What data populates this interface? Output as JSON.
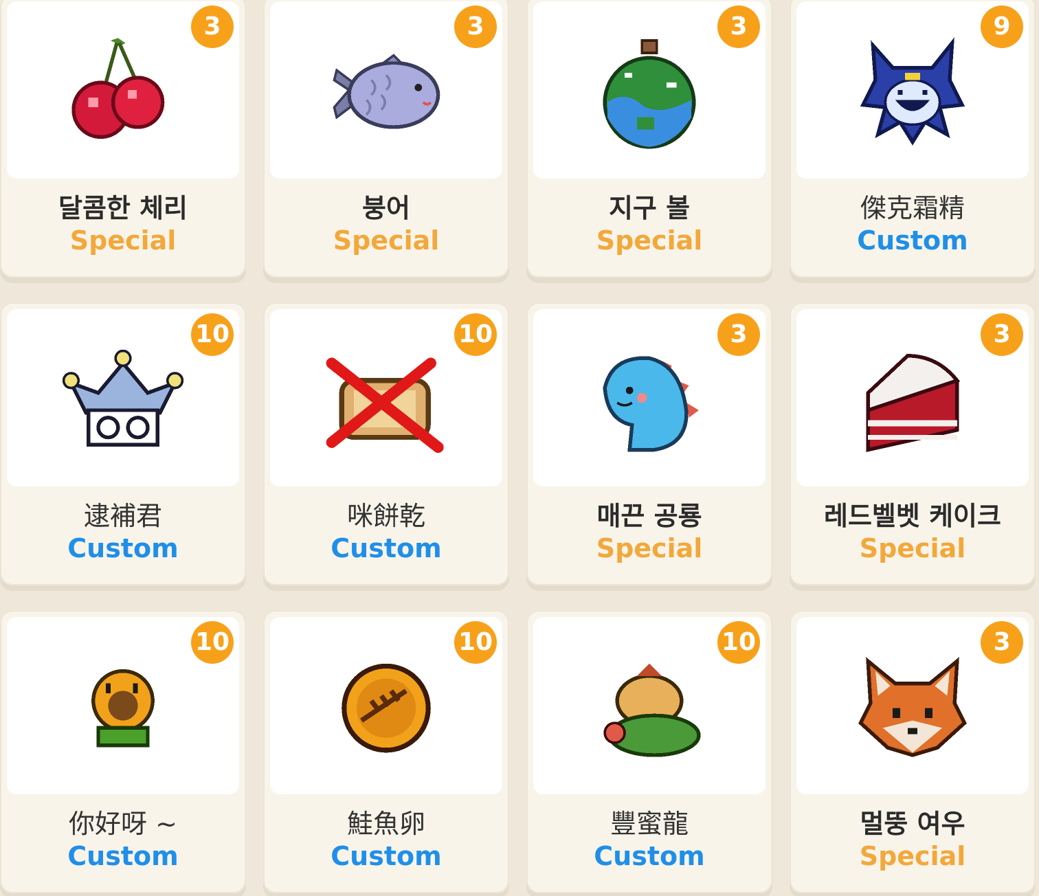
{
  "colors": {
    "special": "#f2a83a",
    "custom": "#1f8fe8",
    "badge": "#f7a11a",
    "card_bg": "#f8f4ea",
    "page_bg": "#efe8da"
  },
  "items": [
    {
      "name": "달콤한 체리",
      "type": "Special",
      "count": "3",
      "icon": "cherry-icon"
    },
    {
      "name": "붕어",
      "type": "Special",
      "count": "3",
      "icon": "fish-bread-icon"
    },
    {
      "name": "지구 볼",
      "type": "Special",
      "count": "3",
      "icon": "earth-ball-icon"
    },
    {
      "name": "傑克霜精",
      "type": "Custom",
      "count": "9",
      "icon": "jack-frost-icon"
    },
    {
      "name": "逮補君",
      "type": "Custom",
      "count": "10",
      "icon": "jester-crown-icon"
    },
    {
      "name": "咪餅乾",
      "type": "Custom",
      "count": "10",
      "icon": "crossed-out-cookie-icon"
    },
    {
      "name": "매끈 공룡",
      "type": "Special",
      "count": "3",
      "icon": "blue-dinosaur-icon"
    },
    {
      "name": "레드벨벳 케이크",
      "type": "Special",
      "count": "3",
      "icon": "red-velvet-cake-icon"
    },
    {
      "name": "你好呀 ~",
      "type": "Custom",
      "count": "10",
      "icon": "sunflower-icon"
    },
    {
      "name": "鮭魚卵",
      "type": "Custom",
      "count": "10",
      "icon": "salmon-roe-coin-icon"
    },
    {
      "name": "豐蜜龍",
      "type": "Custom",
      "count": "10",
      "icon": "honey-dragon-icon"
    },
    {
      "name": "멀뚱 여우",
      "type": "Special",
      "count": "3",
      "icon": "fox-icon"
    }
  ]
}
